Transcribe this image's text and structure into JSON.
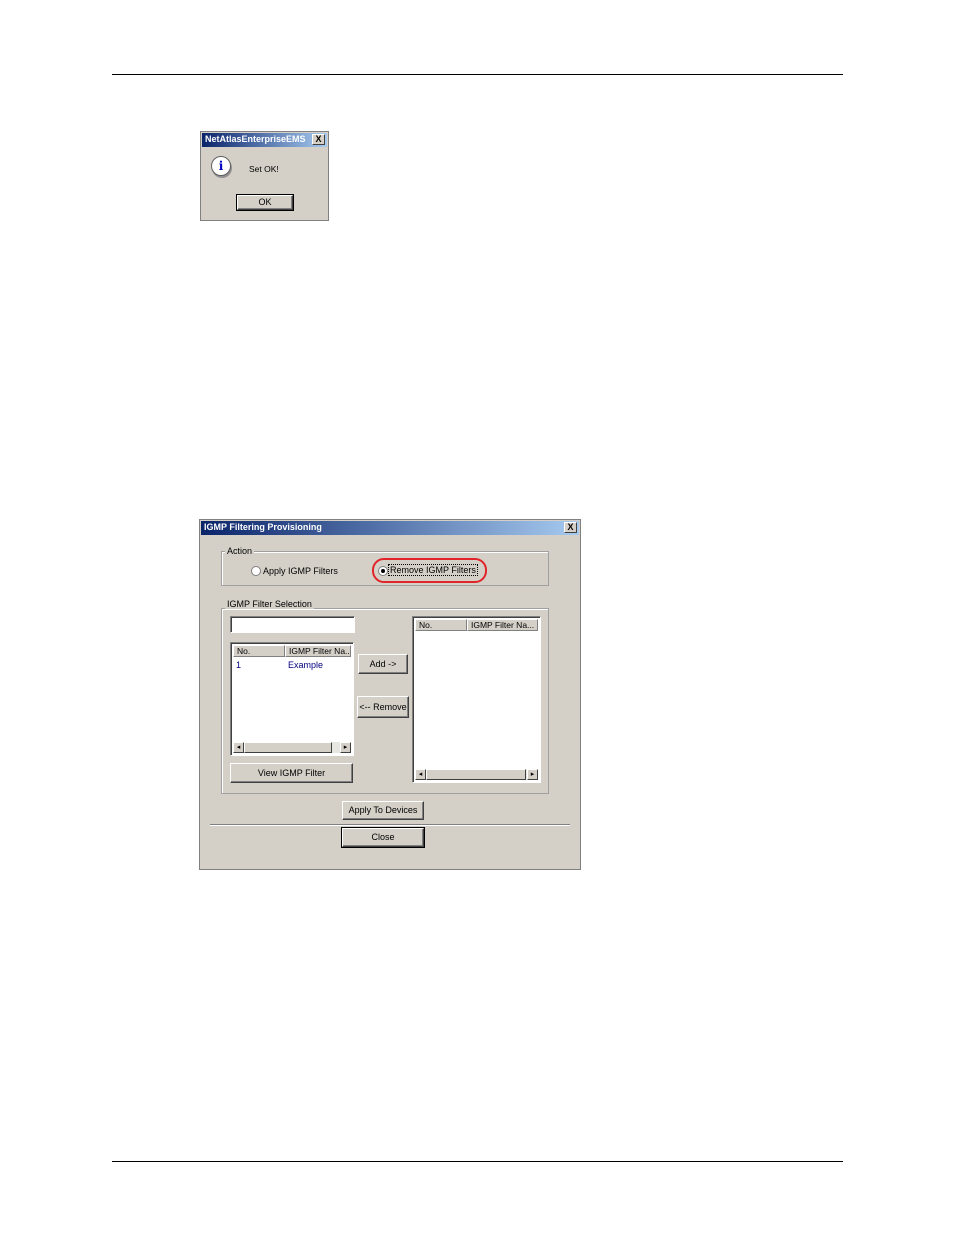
{
  "msgbox": {
    "title": "NetAtlasEnterpriseEMS",
    "close_glyph": "X",
    "icon": "info-icon",
    "icon_glyph": "i",
    "message": "Set OK!",
    "ok_label": "OK"
  },
  "dialog": {
    "title": "IGMP Filtering Provisioning",
    "close_glyph": "X",
    "action_group": {
      "label": "Action",
      "options": [
        {
          "label": "Apply IGMP Filters",
          "selected": false
        },
        {
          "label": "Remove IGMP Filters",
          "selected": true
        }
      ],
      "highlight_color": "#e0242a"
    },
    "selection_group": {
      "label": "IGMP Filter Selection",
      "filter_input_value": "",
      "left_list": {
        "columns": [
          "No.",
          "IGMP Filter Na..."
        ],
        "rows": [
          {
            "no": "1",
            "name": "Example"
          }
        ]
      },
      "right_list": {
        "columns": [
          "No.",
          "IGMP Filter Na..."
        ],
        "rows": []
      },
      "add_label": "Add ->",
      "remove_label": "<-- Remove",
      "view_label": "View IGMP Filter"
    },
    "apply_label": "Apply To Devices",
    "close_label": "Close"
  },
  "scroll": {
    "left_glyph": "◂",
    "right_glyph": "▸"
  }
}
